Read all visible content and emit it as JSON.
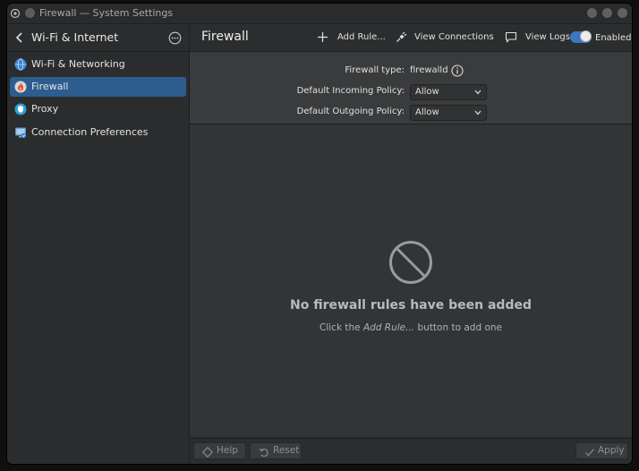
{
  "window": {
    "title": "Firewall — System Settings"
  },
  "sidebar": {
    "title": "Wi-Fi & Internet",
    "items": [
      {
        "label": "Wi-Fi & Networking",
        "icon": "globe-icon",
        "active": false
      },
      {
        "label": "Firewall",
        "icon": "firewall-icon",
        "active": true
      },
      {
        "label": "Proxy",
        "icon": "proxy-icon",
        "active": false
      },
      {
        "label": "Connection Preferences",
        "icon": "network-prefs-icon",
        "active": false
      }
    ]
  },
  "page": {
    "title": "Firewall",
    "actions": {
      "add_rule": "Add Rule...",
      "view_connections": "View Connections",
      "view_logs": "View Logs",
      "enabled_label": "Enabled",
      "enabled": true
    }
  },
  "settings": {
    "firewall_type_label": "Firewall type:",
    "firewall_type_value": "firewalld",
    "incoming_label": "Default Incoming Policy:",
    "incoming_value": "Allow",
    "outgoing_label": "Default Outgoing Policy:",
    "outgoing_value": "Allow"
  },
  "empty_state": {
    "title": "No firewall rules have been added",
    "hint_before": "Click the ",
    "hint_emphasis": "Add Rule...",
    "hint_after": " button to add one"
  },
  "footer": {
    "help": "Help",
    "reset": "Reset",
    "apply": "Apply"
  },
  "colors": {
    "accent": "#2d5c8f",
    "toggle_on": "#3b78c0",
    "window_bg": "#2e2f30"
  }
}
